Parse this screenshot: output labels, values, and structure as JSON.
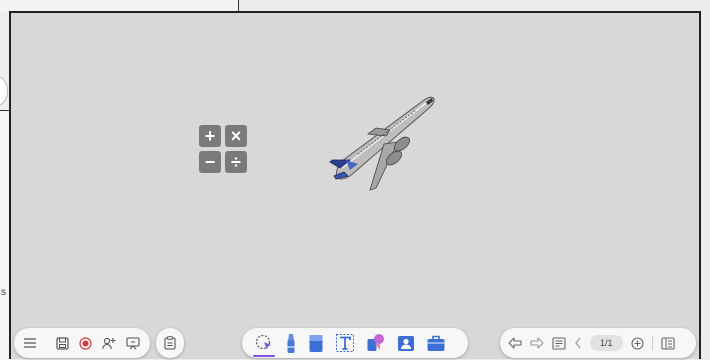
{
  "background": {
    "side_text": "s"
  },
  "canvas": {
    "calculator": {
      "keys": [
        "+",
        "×",
        "−",
        "÷"
      ]
    },
    "object": "airplane-image"
  },
  "toolbar_left": {
    "items": [
      "menu-icon",
      "save-icon",
      "record-icon",
      "add-user-icon",
      "present-icon"
    ]
  },
  "toolbar_clip": {
    "icon": "clipboard-icon"
  },
  "toolbar_tools": {
    "items": [
      "lasso-select-icon",
      "pen-icon",
      "eraser-icon",
      "text-icon",
      "shapes-icon",
      "image-icon",
      "toolbox-icon"
    ],
    "active": "lasso-select-icon",
    "accent": "#7b55e6"
  },
  "toolbar_right": {
    "page_indicator": "1/1",
    "items": [
      "undo-icon",
      "redo-icon",
      "notes-icon",
      "prev-page-icon",
      "add-page-icon",
      "pages-icon"
    ]
  }
}
